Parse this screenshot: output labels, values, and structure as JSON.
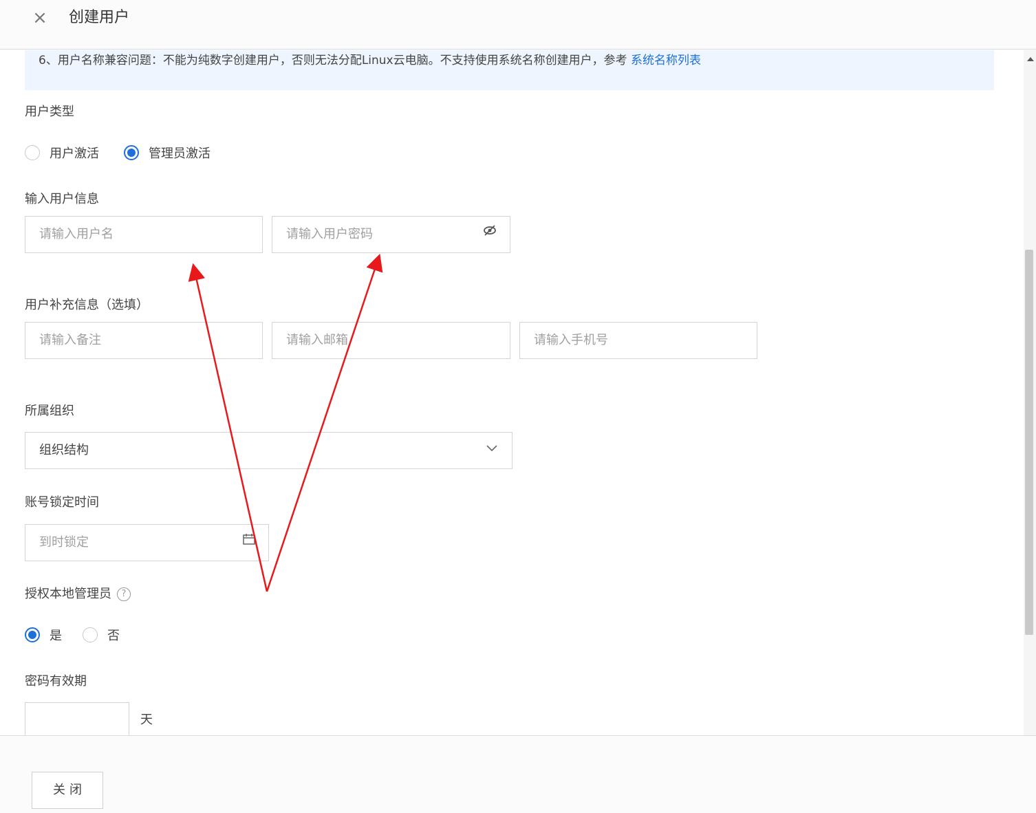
{
  "header": {
    "title": "创建用户",
    "close_glyph": "×"
  },
  "notice": {
    "text": "6、用户名称兼容问题：不能为纯数字创建用户，否则无法分配Linux云电脑。不支持使用系统名称创建用户，参考 ",
    "link": "系统名称列表"
  },
  "user_type": {
    "label": "用户类型",
    "options": [
      {
        "label": "用户激活",
        "checked": false
      },
      {
        "label": "管理员激活",
        "checked": true
      }
    ]
  },
  "user_info": {
    "label": "输入用户信息",
    "username_placeholder": "请输入用户名",
    "password_placeholder": "请输入用户密码"
  },
  "extra_info": {
    "label": "用户补充信息（选填）",
    "remark_placeholder": "请输入备注",
    "email_placeholder": "请输入邮箱",
    "phone_placeholder": "请输入手机号"
  },
  "org": {
    "label": "所属组织",
    "value": "组织结构"
  },
  "lock_time": {
    "label": "账号锁定时间",
    "placeholder": "到时锁定"
  },
  "local_admin": {
    "label": "授权本地管理员",
    "options": [
      {
        "label": "是",
        "checked": true
      },
      {
        "label": "否",
        "checked": false
      }
    ]
  },
  "pwd_validity": {
    "label": "密码有效期",
    "value": "",
    "unit": "天"
  },
  "footer": {
    "close_label": "关闭"
  },
  "colors": {
    "accent": "#1e6fd9",
    "annotation": "#e8191b",
    "notice_bg": "#eef5fe"
  },
  "icons": {
    "eye": "eye-slash-icon",
    "chevron": "chevron-down-icon",
    "calendar": "calendar-icon",
    "help": "question-circle-icon"
  }
}
